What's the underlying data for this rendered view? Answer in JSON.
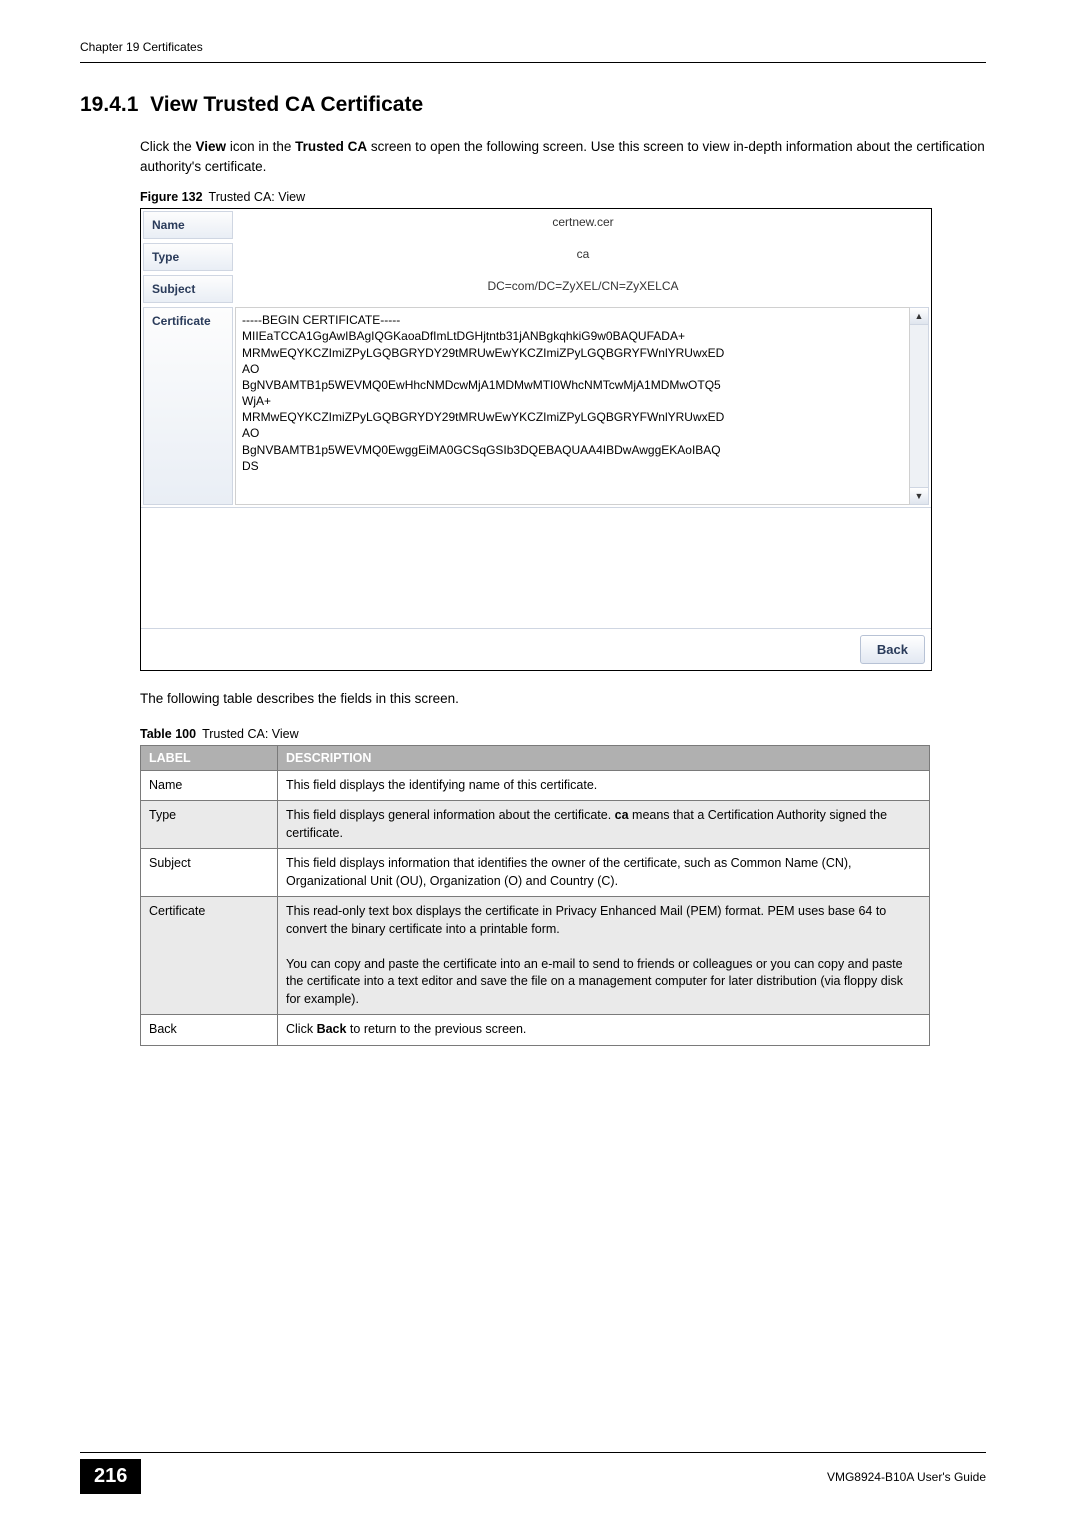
{
  "running_head": "Chapter 19 Certificates",
  "section": {
    "number": "19.4.1",
    "title": "View Trusted CA Certificate"
  },
  "intro_paragraph": "Click the View icon in the Trusted CA screen to open the following screen. Use this screen to view in-depth information about the certification authority's certificate.",
  "intro_bold1": "View",
  "intro_bold2": "Trusted CA",
  "figure": {
    "label": "Figure 132",
    "text": "Trusted CA: View"
  },
  "ui": {
    "rows": {
      "name_label": "Name",
      "name_value": "certnew.cer",
      "type_label": "Type",
      "type_value": "ca",
      "subject_label": "Subject",
      "subject_value": "DC=com/DC=ZyXEL/CN=ZyXELCA",
      "cert_label": "Certificate",
      "cert_value": "-----BEGIN CERTIFICATE-----\nMIIEaTCCA1GgAwIBAgIQGKaoaDfImLtDGHjtntb31jANBgkqhkiG9w0BAQUFADA+\nMRMwEQYKCZImiZPyLGQBGRYDY29tMRUwEwYKCZImiZPyLGQBGRYFWnlYRUwxED\nAO\nBgNVBAMTB1p5WEVMQ0EwHhcNMDcwMjA1MDMwMTI0WhcNMTcwMjA1MDMwOTQ5\nWjA+\nMRMwEQYKCZImiZPyLGQBGRYDY29tMRUwEwYKCZImiZPyLGQBGRYFWnlYRUwxED\nAO\nBgNVBAMTB1p5WEVMQ0EwggEiMA0GCSqGSIb3DQEBAQUAA4IBDwAwggEKAoIBAQ\nDS"
    },
    "back_button": "Back"
  },
  "table_intro": "The following table describes the fields in this screen.",
  "table": {
    "label": "Table 100",
    "text": "Trusted CA: View",
    "headers": {
      "label": "LABEL",
      "description": "DESCRIPTION"
    },
    "rows": [
      {
        "label": "Name",
        "desc": "This field displays the identifying name of this certificate."
      },
      {
        "label": "Type",
        "desc_prefix": "This field displays general information about the certificate. ",
        "desc_bold": "ca",
        "desc_suffix": " means that a Certification Authority signed the certificate."
      },
      {
        "label": "Subject",
        "desc": "This field displays information that identifies the owner of the certificate, such as Common Name (CN), Organizational Unit (OU), Organization (O) and Country (C)."
      },
      {
        "label": "Certificate",
        "desc_p1": "This read-only text box displays the certificate in Privacy Enhanced Mail (PEM) format. PEM uses base 64 to convert the binary certificate into a printable form.",
        "desc_p2": "You can copy and paste the certificate into an e-mail to send to friends or colleagues or you can copy and paste the certificate into a text editor and save the file on a management computer for later distribution (via floppy disk for example)."
      },
      {
        "label": "Back",
        "desc_prefix": "Click ",
        "desc_bold": "Back",
        "desc_suffix": " to return to the previous screen."
      }
    ]
  },
  "footer": {
    "page_number": "216",
    "guide": "VMG8924-B10A User's Guide"
  }
}
